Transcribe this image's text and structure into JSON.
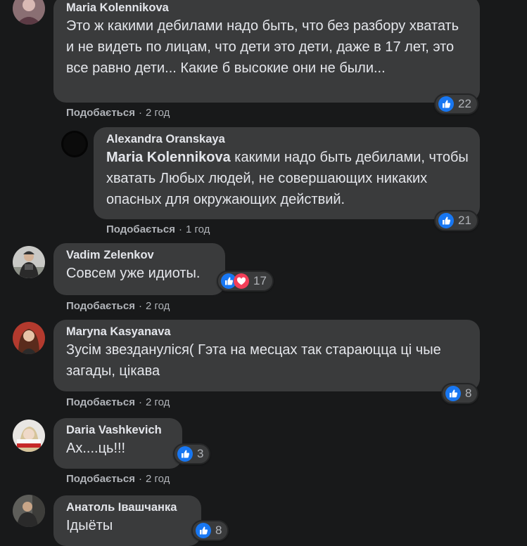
{
  "reaction_label": "Подобається",
  "separator": "·",
  "comments": [
    {
      "author": "Maria Kolennikova",
      "text": "Это ж какими дебилами надо быть, что без разбору хватать и не видеть по лицам, что дети это дети, даже в 17 лет, это все равно дети... Какие б высокие они не были...",
      "mention": "",
      "reaction_count": "22",
      "reactions": [
        "like-icon"
      ],
      "time": "2 год"
    },
    {
      "author": "Alexandra Oranskaya",
      "mention": "Maria Kolennikova",
      "text": "какими надо быть дебилами, чтобы хватать Любых людей, не совершающих никаких опасных для окружающих действий.",
      "reaction_count": "21",
      "reactions": [
        "like-icon"
      ],
      "time": "1 год"
    },
    {
      "author": "Vadim Zelenkov",
      "text": "Совсем уже идиоты.",
      "mention": "",
      "reaction_count": "17",
      "reactions": [
        "like-icon",
        "love-icon"
      ],
      "time": "2 год"
    },
    {
      "author": "Maryna Kasyanava",
      "text": "Зусім звездануліся( Гэта на месцах так стараюцца ці чые загады, цікава",
      "mention": "",
      "reaction_count": "8",
      "reactions": [
        "like-icon"
      ],
      "time": "2 год"
    },
    {
      "author": "Daria Vashkevich",
      "text": "Ах....ць!!!",
      "mention": "",
      "reaction_count": "3",
      "reactions": [
        "like-icon"
      ],
      "time": "2 год"
    },
    {
      "author": "Анатоль Івашчанка",
      "text": "Ідыёты",
      "mention": "",
      "reaction_count": "8",
      "reactions": [
        "like-icon"
      ],
      "time": ""
    }
  ],
  "colors": {
    "page_bg": "#18191a",
    "bubble_bg": "#3a3b3c",
    "text_primary": "#e4e6eb",
    "text_secondary": "#b0b3b8",
    "like_blue": "#1877f2",
    "love_red": "#f33e58"
  }
}
